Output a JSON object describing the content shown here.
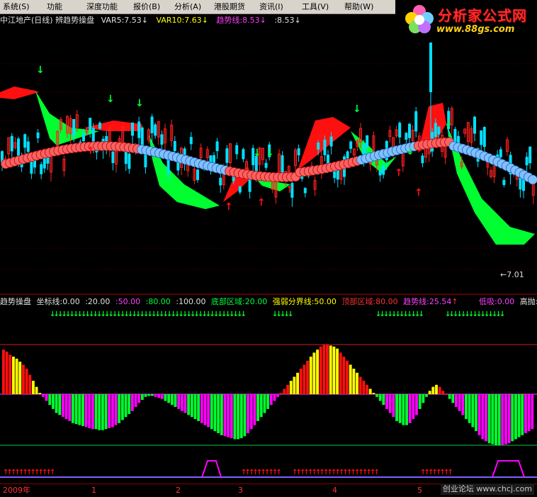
{
  "menubar": {
    "items": [
      "系统(S)",
      "功能",
      "深度功能",
      "报价(B)",
      "分析(A)",
      "港股期货",
      "资讯(I)",
      "工具(V)",
      "帮助(W)"
    ]
  },
  "logo": {
    "title": "分析家公式网",
    "url": "www.88gs.com"
  },
  "main_legend": {
    "title": "中江地产(日线) 辨趋势操盘",
    "var5": "VAR5:7.53",
    "var10": "VAR10:7.63",
    "trend": "趋势线:8.53",
    "extra": ":8.53",
    "down_arrow": "↓"
  },
  "price_low_label": "←7.01",
  "sub_legend": {
    "title": "趋势操盘",
    "coord": "坐标线:0.00",
    "v20": ":20.00",
    "v50": ":50.00",
    "v80": ":80.00",
    "v100": ":100.00",
    "bottom_zone": "底部区域:20.00",
    "strong_weak": "强弱分界线:50.00",
    "top_zone": "顶部区域:80.00",
    "trend": "趋势线:25.54",
    "up_arrow": "↑",
    "low_buy": "低吸:0.00",
    "high_sell": "高抛:"
  },
  "date_axis": {
    "labels": [
      "2009年",
      "1",
      "2",
      "3",
      "4",
      "5"
    ]
  },
  "watermark": "创业论坛 www.chcj.com",
  "colors": {
    "up": "#ff2020",
    "down": "#00e0ff",
    "green_band": "#00ff30",
    "red_band": "#ff1010",
    "ball_red": "#ff6060",
    "ball_blue": "#80c0ff",
    "magenta": "#ff00ff",
    "yellow": "#ffff00"
  },
  "chart_data": {
    "type": "bar",
    "title": "",
    "series": [
      {
        "values": [
          95,
          93,
          90,
          88,
          86,
          83,
          80,
          76,
          70,
          64,
          58,
          52,
          48,
          44,
          40,
          36,
          32,
          30,
          28,
          26,
          24,
          22,
          21,
          20,
          19,
          18,
          17,
          16,
          16,
          15,
          15,
          16,
          17,
          18,
          20,
          22,
          25,
          28,
          31,
          34,
          38,
          42,
          45,
          48,
          49,
          49,
          48,
          47,
          46,
          44,
          42,
          40,
          38,
          36,
          34,
          32,
          30,
          28,
          26,
          24,
          22,
          20,
          18,
          16,
          14,
          12,
          10,
          9,
          8,
          7,
          6,
          6,
          7,
          9,
          12,
          16,
          20,
          24,
          28,
          32,
          36,
          40,
          44,
          48,
          52,
          56,
          60,
          64,
          68,
          72,
          76,
          80,
          84,
          88,
          92,
          95,
          98,
          100,
          100,
          99,
          98,
          96,
          92,
          88,
          84,
          80,
          76,
          72,
          68,
          64,
          60,
          56,
          52,
          48,
          44,
          40,
          36,
          32,
          28,
          24,
          22,
          20,
          20,
          22,
          26,
          30,
          36,
          42,
          48,
          54,
          58,
          60,
          58,
          54,
          50,
          46,
          42,
          38,
          34,
          30,
          26,
          22,
          18,
          14,
          10,
          6,
          4,
          2,
          1,
          0,
          0,
          0,
          1,
          2,
          4,
          6,
          8,
          10,
          12,
          14,
          16
        ]
      }
    ]
  }
}
